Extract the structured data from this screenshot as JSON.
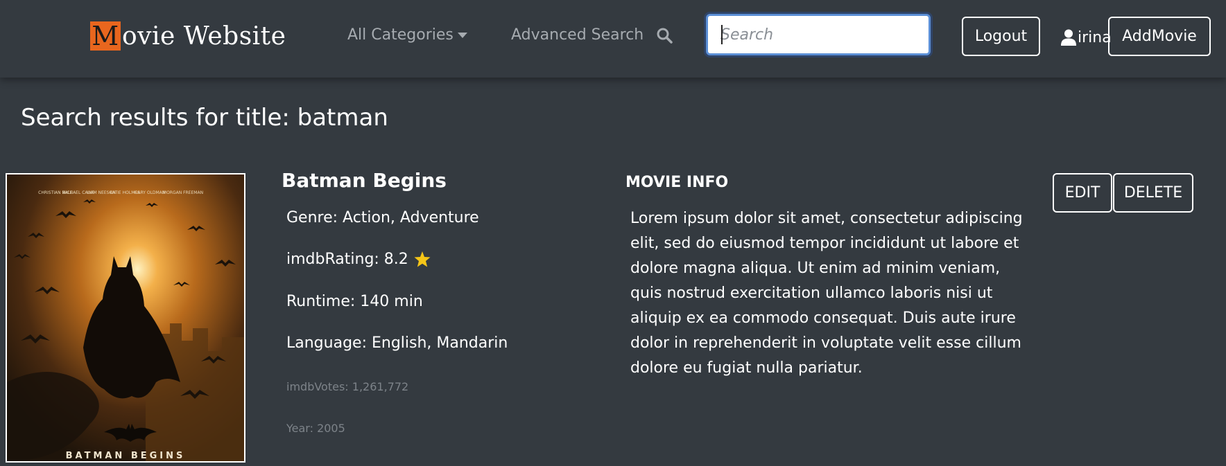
{
  "navbar": {
    "brand_initial": "M",
    "brand_rest": "ovie Website",
    "categories_label": "All Categories",
    "advanced_search_label": "Advanced Search",
    "search_placeholder": "Search",
    "search_value": "",
    "logout_label": "Logout",
    "username": "irina",
    "add_movie_label": "AddMovie"
  },
  "page": {
    "title": "Search results for title: batman"
  },
  "movie": {
    "title": "Batman Begins",
    "genre": "Genre: Action, Adventure",
    "imdb_rating": "imdbRating: 8.2",
    "runtime": "Runtime: 140 min",
    "language": "Language: English, Mandarin",
    "imdb_votes": "imdbVotes: 1,261,772",
    "year": "Year: 2005",
    "info_heading": "MOVIE INFO",
    "info_text": "Lorem ipsum dolor sit amet, consectetur adipiscing elit, sed do eiusmod tempor incididunt ut labore et dolore magna aliqua. Ut enim ad minim veniam, quis nostrud exercitation ullamco laboris nisi ut aliquip ex ea commodo consequat. Duis aute irure dolor in reprehenderit in voluptate velit esse cillum dolore eu fugiat nulla pariatur.",
    "edit_label": "EDIT",
    "delete_label": "DELETE",
    "poster": {
      "cast": [
        "CHRISTIAN BALE",
        "MICHAEL CAINE",
        "LIAM NEESON",
        "KATIE HOLMES",
        "GARY OLDMAN",
        "MORGAN FREEMAN"
      ],
      "title": "BATMAN BEGINS"
    }
  },
  "colors": {
    "background": "#343a40",
    "brand_accent": "#e8661e",
    "muted_text": "#a6abb0",
    "star": "#f5c518",
    "search_focus": "#5b8fd6"
  }
}
